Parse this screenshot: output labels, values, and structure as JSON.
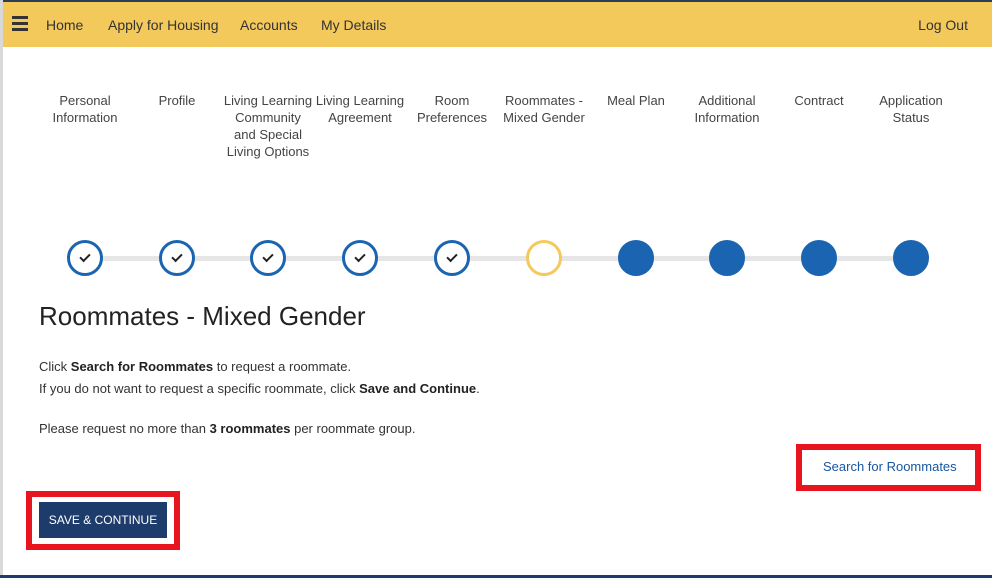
{
  "nav": {
    "items": [
      "Home",
      "Apply for Housing",
      "Accounts",
      "My Details"
    ],
    "logout": "Log Out"
  },
  "steps": [
    {
      "label": "Personal Information",
      "status": "done"
    },
    {
      "label": "Profile",
      "status": "done"
    },
    {
      "label": "Living Learning Community and Special Living Options",
      "status": "done"
    },
    {
      "label": "Living Learning Agreement",
      "status": "done"
    },
    {
      "label": "Room Preferences",
      "status": "done"
    },
    {
      "label": "Roommates - Mixed Gender",
      "status": "current"
    },
    {
      "label": "Meal Plan",
      "status": "todo"
    },
    {
      "label": "Additional Information",
      "status": "todo"
    },
    {
      "label": "Contract",
      "status": "todo"
    },
    {
      "label": "Application Status",
      "status": "todo"
    }
  ],
  "main": {
    "title": "Roommates - Mixed Gender",
    "line1_pre": "Click ",
    "line1_bold": "Search for Roommates",
    "line1_post": " to request a roommate.",
    "line2_pre": "If you do not want to request a specific roommate, click ",
    "line2_bold": "Save and Continue",
    "line2_post": ".",
    "line3_pre": "Please request no more than ",
    "line3_bold": "3 roommates",
    "line3_post": " per roommate group.",
    "search_link": "Search for Roommates",
    "save_button": "SAVE & CONTINUE"
  },
  "colors": {
    "navbar": "#f3c95c",
    "step_blue": "#1a64b2",
    "step_current": "#f3c95c",
    "button": "#1d3c6b",
    "highlight": "#e8141e"
  }
}
